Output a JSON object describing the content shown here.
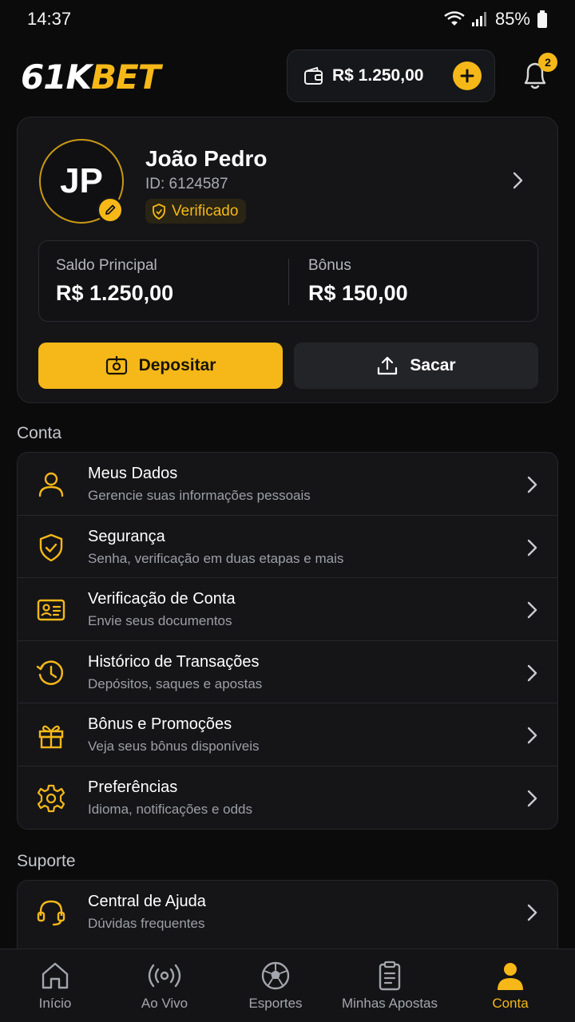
{
  "status_bar": {
    "time": "14:37",
    "battery": "85%"
  },
  "header": {
    "logo_part1": "61K",
    "logo_part2": "BET",
    "wallet_amount": "R$ 1.250,00",
    "notifications_count": "2"
  },
  "profile": {
    "initials": "JP",
    "name": "João Pedro",
    "id_label": "ID: 6124587",
    "verified_label": "Verificado",
    "main_balance_label": "Saldo Principal",
    "main_balance_value": "R$ 1.250,00",
    "bonus_label": "Bônus",
    "bonus_value": "R$ 150,00",
    "deposit_label": "Depositar",
    "withdraw_label": "Sacar"
  },
  "account_section": {
    "title": "Conta",
    "items": [
      {
        "title": "Meus Dados",
        "subtitle": "Gerencie suas informações pessoais",
        "icon": "user-icon"
      },
      {
        "title": "Segurança",
        "subtitle": "Senha, verificação em duas etapas e mais",
        "icon": "shield-check-icon"
      },
      {
        "title": "Verificação de Conta",
        "subtitle": "Envie seus documentos",
        "icon": "id-card-icon"
      },
      {
        "title": "Histórico de Transações",
        "subtitle": "Depósitos, saques e apostas",
        "icon": "history-icon"
      },
      {
        "title": "Bônus e Promoções",
        "subtitle": "Veja seus bônus disponíveis",
        "icon": "gift-icon"
      },
      {
        "title": "Preferências",
        "subtitle": "Idioma, notificações e odds",
        "icon": "gear-icon"
      }
    ]
  },
  "support_section": {
    "title": "Suporte",
    "items": [
      {
        "title": "Central de Ajuda",
        "subtitle": "Dúvidas frequentes",
        "icon": "headset-icon"
      }
    ]
  },
  "bottom_nav": {
    "items": [
      {
        "label": "Início",
        "icon": "home-icon"
      },
      {
        "label": "Ao Vivo",
        "icon": "live-icon"
      },
      {
        "label": "Esportes",
        "icon": "soccer-ball-icon"
      },
      {
        "label": "Minhas Apostas",
        "icon": "clipboard-icon"
      },
      {
        "label": "Conta",
        "icon": "user-filled-icon",
        "active": true
      }
    ]
  },
  "colors": {
    "accent": "#f5b818",
    "background": "#0b0b0c",
    "card": "#151518"
  }
}
